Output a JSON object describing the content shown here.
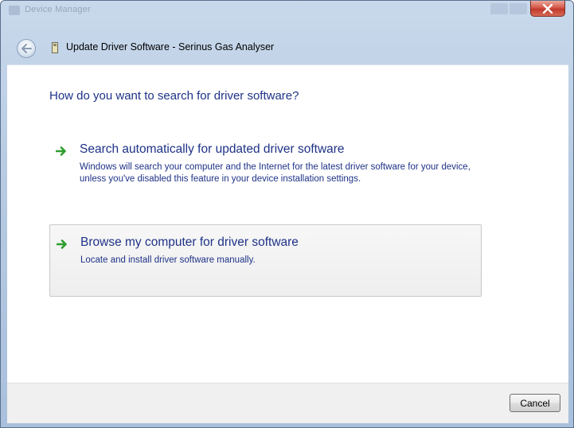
{
  "titlebar": {
    "ghost_title": "Device Manager",
    "close_icon": "close-x-icon"
  },
  "dialog": {
    "title": "Update Driver Software - Serinus Gas Analyser",
    "back_icon": "back-arrow-icon",
    "device_icon": "device-icon"
  },
  "main": {
    "heading": "How do you want to search for driver software?",
    "options": [
      {
        "icon": "green-arrow-icon",
        "title": "Search automatically for updated driver software",
        "description": "Windows will search your computer and the Internet for the latest driver software for your device, unless you've disabled this feature in your device installation settings."
      },
      {
        "icon": "green-arrow-icon",
        "title": "Browse my computer for driver software",
        "description": "Locate and install driver software manually."
      }
    ]
  },
  "footer": {
    "cancel_label": "Cancel"
  },
  "colors": {
    "link_blue": "#1e3287",
    "arrow_green": "#2e9e2e",
    "close_red": "#c0392b"
  }
}
